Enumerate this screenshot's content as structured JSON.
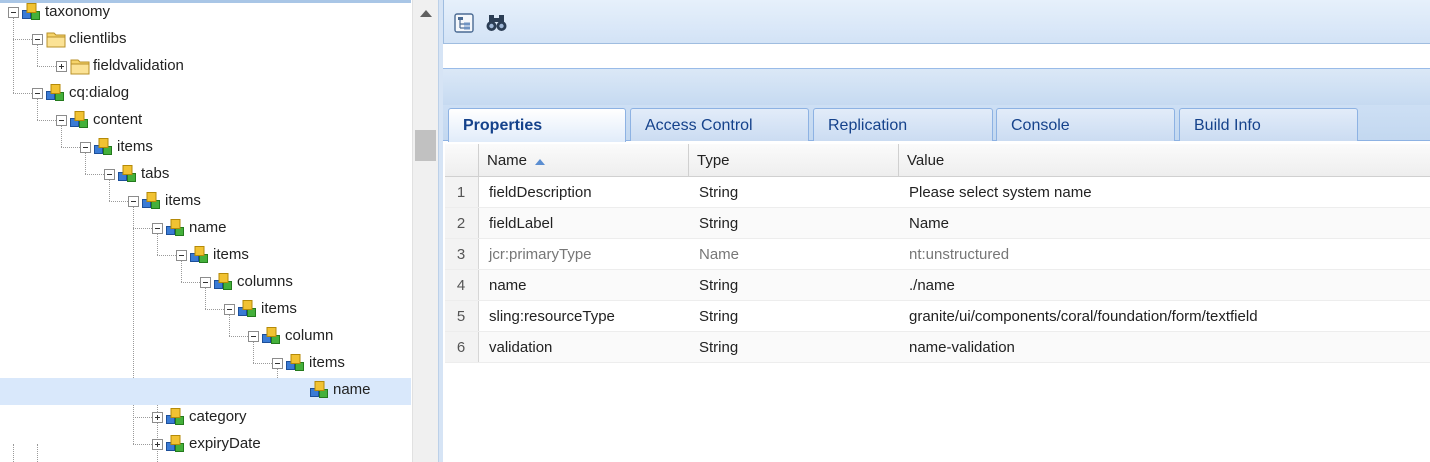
{
  "tree": {
    "items": [
      {
        "label": "taxonomy",
        "icon": "node-icon",
        "toggle": "minus"
      },
      {
        "label": "clientlibs",
        "icon": "folder-icon",
        "toggle": "minus"
      },
      {
        "label": "fieldvalidation",
        "icon": "folder-icon",
        "toggle": "plus"
      },
      {
        "label": "cq:dialog",
        "icon": "node-icon",
        "toggle": "minus"
      },
      {
        "label": "content",
        "icon": "node-icon",
        "toggle": "minus"
      },
      {
        "label": "items",
        "icon": "node-icon",
        "toggle": "minus"
      },
      {
        "label": "tabs",
        "icon": "node-icon",
        "toggle": "minus"
      },
      {
        "label": "items",
        "icon": "node-icon",
        "toggle": "minus"
      },
      {
        "label": "name",
        "icon": "node-icon",
        "toggle": "minus"
      },
      {
        "label": "items",
        "icon": "node-icon",
        "toggle": "minus"
      },
      {
        "label": "columns",
        "icon": "node-icon",
        "toggle": "minus"
      },
      {
        "label": "items",
        "icon": "node-icon",
        "toggle": "minus"
      },
      {
        "label": "column",
        "icon": "node-icon",
        "toggle": "minus"
      },
      {
        "label": "items",
        "icon": "node-icon",
        "toggle": "minus"
      },
      {
        "label": "name",
        "icon": "node-icon",
        "toggle": "none",
        "selected": true
      },
      {
        "label": "category",
        "icon": "node-icon",
        "toggle": "plus"
      },
      {
        "label": "expiryDate",
        "icon": "node-icon",
        "toggle": "plus"
      }
    ]
  },
  "toolbar": {
    "buttons": [
      {
        "icon": "tree-view-icon"
      },
      {
        "icon": "binoculars-icon"
      }
    ]
  },
  "tabs": [
    {
      "label": "Properties",
      "active": true
    },
    {
      "label": "Access Control",
      "active": false
    },
    {
      "label": "Replication",
      "active": false
    },
    {
      "label": "Console",
      "active": false
    },
    {
      "label": "Build Info",
      "active": false
    }
  ],
  "grid": {
    "columns": [
      "Name",
      "Type",
      "Value"
    ],
    "sort": {
      "column": "Name",
      "direction": "ascending"
    },
    "rows": [
      {
        "num": "1",
        "name": "fieldDescription",
        "type": "String",
        "value": "Please select system name"
      },
      {
        "num": "2",
        "name": "fieldLabel",
        "type": "String",
        "value": "Name"
      },
      {
        "num": "3",
        "name": "jcr:primaryType",
        "type": "Name",
        "value": "nt:unstructured",
        "muted": true
      },
      {
        "num": "4",
        "name": "name",
        "type": "String",
        "value": "./name"
      },
      {
        "num": "5",
        "name": "sling:resourceType",
        "type": "String",
        "value": "granite/ui/components/coral/foundation/form/textfield"
      },
      {
        "num": "6",
        "name": "validation",
        "type": "String",
        "value": "name-validation"
      }
    ]
  },
  "colors": {
    "selection": "#d9e8fb",
    "tab_text": "#15428b",
    "toolbar": "#d3e3f6"
  }
}
